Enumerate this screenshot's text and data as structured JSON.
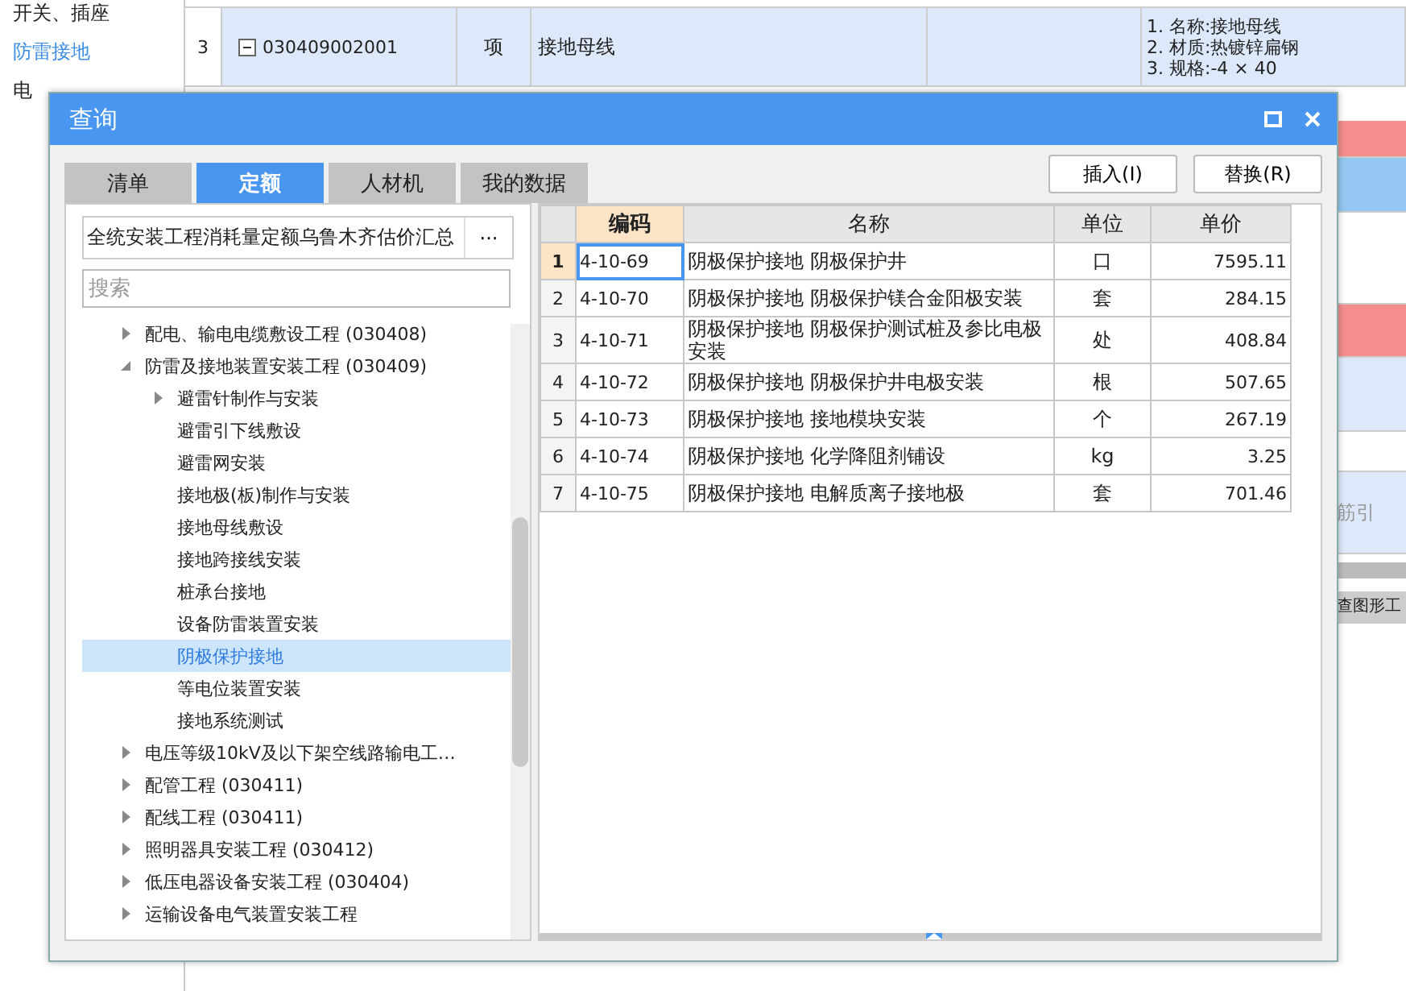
{
  "background": {
    "sidebar": [
      {
        "label": "开关、插座",
        "selected": false
      },
      {
        "label": "防雷接地",
        "selected": true
      },
      {
        "label": "电",
        "selected": false
      }
    ],
    "row": {
      "number": "3",
      "code": "030409002001",
      "unit": "项",
      "name": "接地母线",
      "features": [
        "1. 名称:接地母线",
        "2. 材质:热镀锌扁钢",
        "3. 规格:-4 × 40"
      ]
    },
    "side_strips": [
      {
        "color": "#f58e8e"
      },
      {
        "color": "#94c8f2"
      },
      {
        "color": "#ffffff"
      },
      {
        "color": "#f58e8e"
      },
      {
        "color": "#dde9fa"
      },
      {
        "color": "#ffffff"
      },
      {
        "color": "#dde9fa",
        "text": "筋引"
      }
    ],
    "side_tab": "查图形工"
  },
  "dialog": {
    "title": "查询",
    "tabs": [
      {
        "label": "清单",
        "selected": false
      },
      {
        "label": "定额",
        "selected": true
      },
      {
        "label": "人材机",
        "selected": false
      },
      {
        "label": "我的数据",
        "selected": false
      }
    ],
    "buttons": [
      "插入(I)",
      "替换(R)"
    ],
    "library": "全统安装工程消耗量定额乌鲁木齐估价汇总",
    "library_button": "···",
    "search": {
      "placeholder": "搜索"
    },
    "tree": [
      {
        "label": "配电、输电电缆敷设工程 (030408)",
        "expanded": false,
        "selected": false
      },
      {
        "label": "防雷及接地装置安装工程 (030409)",
        "expanded": true,
        "selected": false,
        "children": [
          {
            "label": "避雷针制作与安装",
            "expanded": false,
            "selected": false,
            "has_children": true
          },
          {
            "label": "避雷引下线敷设",
            "selected": false
          },
          {
            "label": "避雷网安装",
            "selected": false
          },
          {
            "label": "接地极(板)制作与安装",
            "selected": false
          },
          {
            "label": "接地母线敷设",
            "selected": false
          },
          {
            "label": "接地跨接线安装",
            "selected": false
          },
          {
            "label": "桩承台接地",
            "selected": false
          },
          {
            "label": "设备防雷装置安装",
            "selected": false
          },
          {
            "label": "阴极保护接地",
            "selected": true
          },
          {
            "label": "等电位装置安装",
            "selected": false
          },
          {
            "label": "接地系统测试",
            "selected": false
          }
        ]
      },
      {
        "label": "电压等级10kV及以下架空线路输电工…",
        "expanded": false,
        "selected": false
      },
      {
        "label": "配管工程 (030411)",
        "expanded": false,
        "selected": false
      },
      {
        "label": "配线工程 (030411)",
        "expanded": false,
        "selected": false
      },
      {
        "label": "照明器具安装工程 (030412)",
        "expanded": false,
        "selected": false
      },
      {
        "label": "低压电器设备安装工程 (030404)",
        "expanded": false,
        "selected": false
      },
      {
        "label": "运输设备电气装置安装工程",
        "expanded": false,
        "selected": false
      }
    ],
    "table": {
      "columns": [
        "编码",
        "名称",
        "单位",
        "单价"
      ],
      "rows": [
        {
          "index": "1",
          "code": "4-10-69",
          "name": "阴极保护接地 阴极保护井",
          "unit": "口",
          "price": "7595.11",
          "selected": true
        },
        {
          "index": "2",
          "code": "4-10-70",
          "name": "阴极保护接地 阴极保护镁合金阳极安装",
          "unit": "套",
          "price": "284.15",
          "selected": false
        },
        {
          "index": "3",
          "code": "4-10-71",
          "name": "阴极保护接地 阴极保护测试桩及参比电极安装",
          "unit": "处",
          "price": "408.84",
          "selected": false
        },
        {
          "index": "4",
          "code": "4-10-72",
          "name": "阴极保护接地 阴极保护井电极安装",
          "unit": "根",
          "price": "507.65",
          "selected": false
        },
        {
          "index": "5",
          "code": "4-10-73",
          "name": "阴极保护接地 接地模块安装",
          "unit": "个",
          "price": "267.19",
          "selected": false
        },
        {
          "index": "6",
          "code": "4-10-74",
          "name": "阴极保护接地 化学降阻剂铺设",
          "unit": "kg",
          "price": "3.25",
          "selected": false
        },
        {
          "index": "7",
          "code": "4-10-75",
          "name": "阴极保护接地 电解质离子接地极",
          "unit": "套",
          "price": "701.46",
          "selected": false
        }
      ]
    }
  }
}
